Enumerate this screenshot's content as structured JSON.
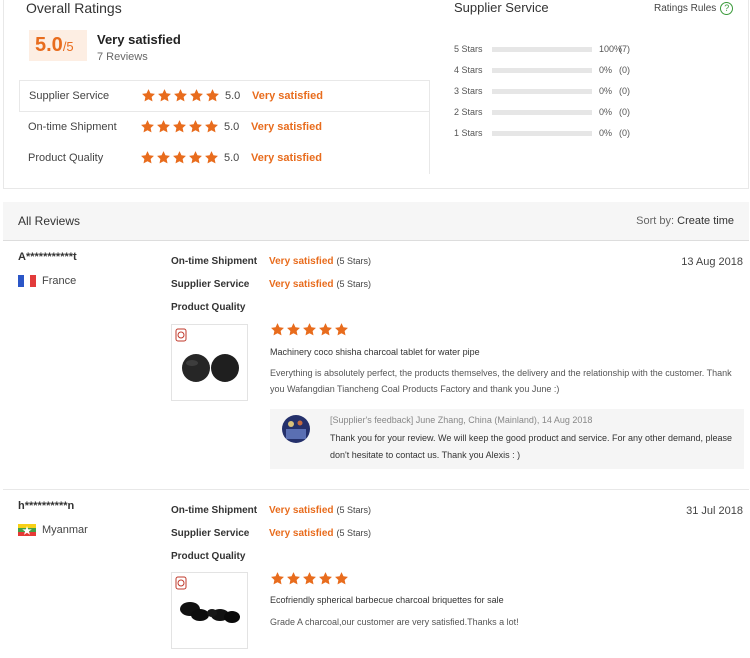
{
  "overall": {
    "title": "Overall Ratings",
    "score": "5.0",
    "score_denominator": "/5",
    "verdict": "Very satisfied",
    "review_count": "7 Reviews",
    "categories": [
      {
        "name": "Supplier Service",
        "score": "5.0",
        "verdict": "Very satisfied",
        "stars": 5
      },
      {
        "name": "On-time Shipment",
        "score": "5.0",
        "verdict": "Very satisfied",
        "stars": 5
      },
      {
        "name": "Product Quality",
        "score": "5.0",
        "verdict": "Very satisfied",
        "stars": 5
      }
    ]
  },
  "supplier_service": {
    "title": "Supplier Service",
    "rules_label": "Ratings Rules",
    "rules_icon": "question-circle-icon",
    "distribution": [
      {
        "label": "5 Stars",
        "pct": "100%",
        "count": "(7)",
        "fill": 1.0
      },
      {
        "label": "4 Stars",
        "pct": "0%",
        "count": "(0)",
        "fill": 0
      },
      {
        "label": "3 Stars",
        "pct": "0%",
        "count": "(0)",
        "fill": 0
      },
      {
        "label": "2 Stars",
        "pct": "0%",
        "count": "(0)",
        "fill": 0
      },
      {
        "label": "1 Stars",
        "pct": "0%",
        "count": "(0)",
        "fill": 0
      }
    ]
  },
  "all_reviews": {
    "title": "All Reviews",
    "sort_label": "Sort by:",
    "sort_value": "Create time"
  },
  "labels": {
    "shipment": "On-time Shipment",
    "service": "Supplier Service",
    "quality": "Product Quality"
  },
  "reviews": [
    {
      "user": "A***********t",
      "country": "France",
      "flag_icon": "france-flag-icon",
      "date": "13 Aug 2018",
      "shipment_verdict": "Very satisfied",
      "shipment_stars": "(5 Stars)",
      "service_verdict": "Very satisfied",
      "service_stars": "(5 Stars)",
      "quality_stars": 5,
      "product": "Machinery coco shisha charcoal tablet for water pipe",
      "body": "Everything is absolutely perfect, the products themselves, the delivery and the relationship with the customer. Thank you Wafangdian Tiancheng Coal Products Factory and thank you June :)",
      "feedback_meta": "[Supplier's feedback] June Zhang, China (Mainland), 14 Aug 2018",
      "feedback_text": "Thank you for your review. We will keep the good product and service. For any other demand, please don't hesitate to contact us. Thank you Alexis : )"
    },
    {
      "user": "h**********n",
      "country": "Myanmar",
      "flag_icon": "myanmar-flag-icon",
      "date": "31 Jul 2018",
      "shipment_verdict": "Very satisfied",
      "shipment_stars": "(5 Stars)",
      "service_verdict": "Very satisfied",
      "service_stars": "(5 Stars)",
      "quality_stars": 5,
      "product": "Ecofriendly spherical barbecue charcoal briquettes for sale",
      "body": "Grade A charcoal,our customer are very satisfied.Thanks a lot!"
    }
  ],
  "colors": {
    "accent": "#e86c1d",
    "score_bg": "#fdeee3"
  }
}
